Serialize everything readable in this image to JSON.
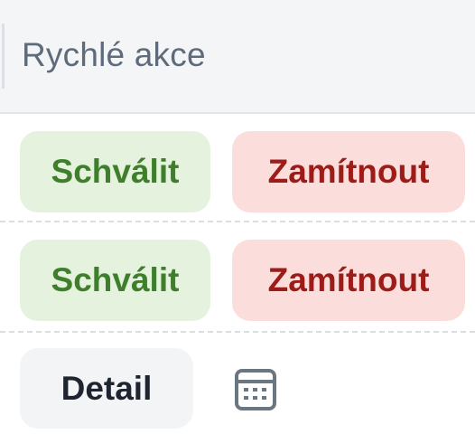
{
  "header": {
    "title": "Rychlé akce"
  },
  "rows": [
    {
      "approve_label": "Schválit",
      "reject_label": "Zamítnout"
    },
    {
      "approve_label": "Schválit",
      "reject_label": "Zamítnout"
    }
  ],
  "footer": {
    "detail_label": "Detail",
    "icon": "calendar-icon"
  },
  "colors": {
    "approve_bg": "#e4f2de",
    "approve_text": "#3f7f2b",
    "reject_bg": "#fbdedb",
    "reject_text": "#9b1c18",
    "detail_bg": "#f3f4f6",
    "icon": "#6b7683"
  }
}
